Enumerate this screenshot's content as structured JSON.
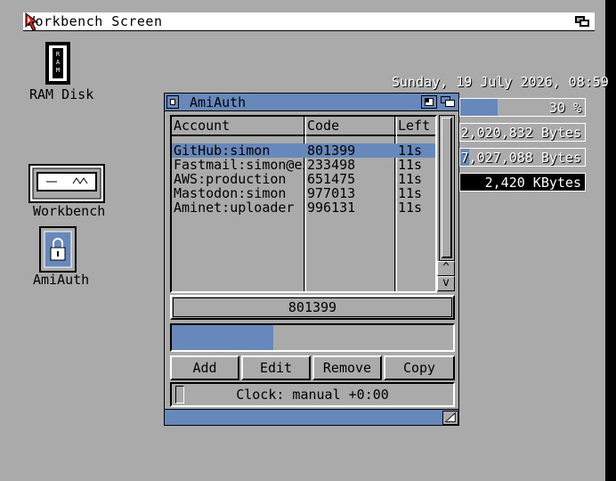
{
  "screen": {
    "title": "Workbench Screen"
  },
  "desktop_icons": [
    {
      "label": "RAM Disk",
      "icon": "ram-disk-icon"
    },
    {
      "label": "Workbench",
      "icon": "disk-drive-icon"
    },
    {
      "label": "AmiAuth",
      "icon": "lock-app-icon"
    }
  ],
  "info": {
    "datetime": "Sunday, 19 July 2026, 08:59",
    "cpu_text": "30 %",
    "cpu_fraction": 0.3,
    "chip_text": "2,020,832 Bytes",
    "fast_text": "7,027,088 Bytes",
    "vmem_text": "2,420 KBytes"
  },
  "window": {
    "title": "AmiAuth",
    "columns": {
      "account": "Account",
      "code": "Code",
      "left": "Left"
    },
    "rows": [
      {
        "account": "GitHub:simon",
        "code": "801399",
        "left": "11s",
        "selected": true
      },
      {
        "account": "Fastmail:simon@exa",
        "code": "233498",
        "left": "11s",
        "selected": false
      },
      {
        "account": "AWS:production",
        "code": "651475",
        "left": "11s",
        "selected": false
      },
      {
        "account": "Mastodon:simon",
        "code": "977013",
        "left": "11s",
        "selected": false
      },
      {
        "account": "Aminet:uploader",
        "code": "996131",
        "left": "11s",
        "selected": false
      }
    ],
    "current_code": "801399",
    "progress_fraction": 0.36,
    "buttons": {
      "add": "Add",
      "edit": "Edit",
      "remove": "Remove",
      "copy": "Copy"
    },
    "scroll_up": "^",
    "scroll_down": "v",
    "clock_status": "Clock: manual +0:00"
  },
  "colors": {
    "background": "#aaaaaa",
    "accent": "#6688bb",
    "highlight": "#ffffff",
    "shadow": "#000000"
  }
}
